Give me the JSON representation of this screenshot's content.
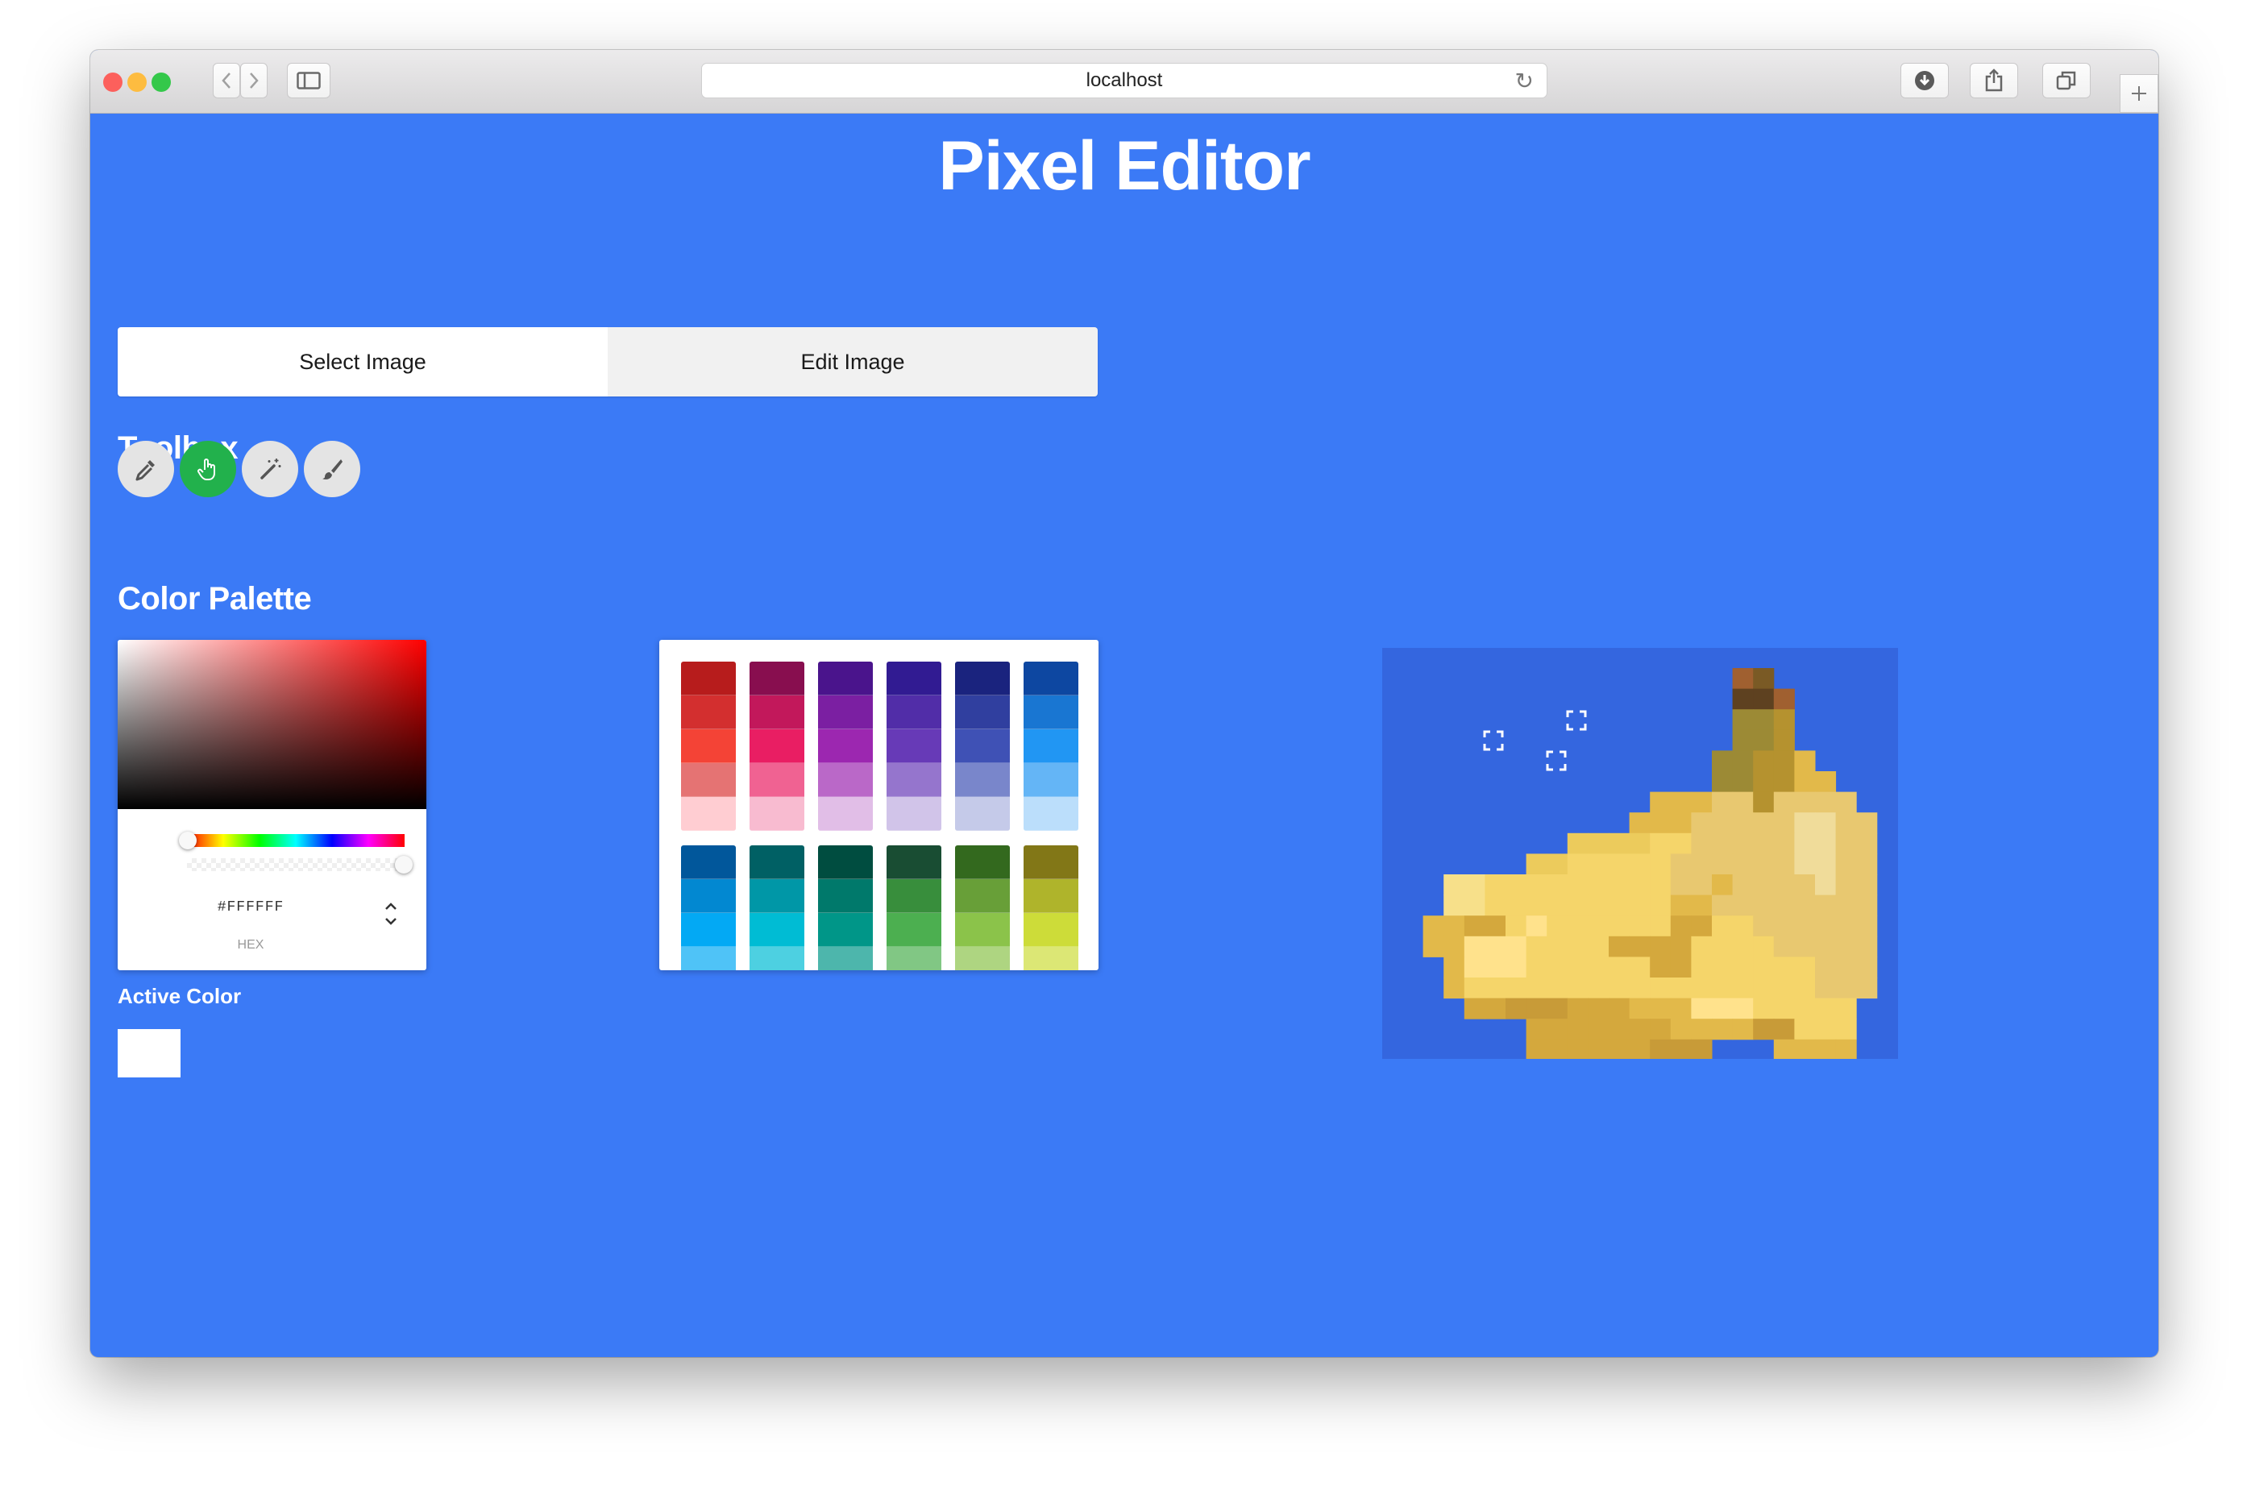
{
  "browser": {
    "url": "localhost"
  },
  "app": {
    "title": "Pixel Editor"
  },
  "tabs": [
    {
      "label": "Select Image",
      "active": true
    },
    {
      "label": "Edit Image",
      "active": false
    }
  ],
  "toolbox": {
    "heading": "Toolbox",
    "tools": [
      {
        "icon": "eyedropper-icon",
        "selected": false
      },
      {
        "icon": "hand-pointer-icon",
        "selected": true
      },
      {
        "icon": "magic-wand-icon",
        "selected": false
      },
      {
        "icon": "paintbrush-icon",
        "selected": false
      }
    ]
  },
  "palette": {
    "heading": "Color Palette",
    "picker": {
      "hex_value": "#FFFFFF",
      "format_label": "HEX",
      "hue_color": "#ff0000"
    },
    "active_color_label": "Active Color",
    "active_color": "#ffffff",
    "swatch_groups": [
      [
        [
          "#b71c1c",
          "#d32f2f",
          "#f44336",
          "#e57373",
          "#ffcdd2"
        ],
        [
          "#880e4f",
          "#c2185b",
          "#e91e63",
          "#f06292",
          "#f8bbd0"
        ],
        [
          "#4a148c",
          "#7b1fa2",
          "#9c27b0",
          "#ba68c8",
          "#e1bee7"
        ],
        [
          "#311b92",
          "#512da8",
          "#673ab7",
          "#9575cd",
          "#d1c4e9"
        ],
        [
          "#1a237e",
          "#303f9f",
          "#3f51b5",
          "#7986cb",
          "#c5cae9"
        ],
        [
          "#0d47a1",
          "#1976d2",
          "#2196f3",
          "#64b5f6",
          "#bbdefb"
        ]
      ],
      [
        [
          "#01579b",
          "#0288d1",
          "#03a9f4",
          "#4fc3f7"
        ],
        [
          "#006064",
          "#0097a7",
          "#00bcd4",
          "#4dd0e1"
        ],
        [
          "#004d40",
          "#00796b",
          "#009688",
          "#4db6ac"
        ],
        [
          "#194d33",
          "#388e3c",
          "#4caf50",
          "#81c784"
        ],
        [
          "#33691e",
          "#689f38",
          "#8bc34a",
          "#aed581"
        ],
        [
          "#827717",
          "#afb42b",
          "#cddc39",
          "#dce775"
        ]
      ]
    ]
  },
  "canvas": {
    "background": "#3466df",
    "pixel_colors": {
      "a": "#f7e08a",
      "b": "#f5d56a",
      "c": "#eccb5c",
      "d": "#e2b94a",
      "e": "#d4a83d",
      "f": "#c89b38",
      "g": "#b5922f",
      "h": "#9c8a35",
      "i": "#7a5a25",
      "j": "#5e4120",
      "k": "#a06030",
      "l": "#f0dc9a",
      "m": "#e8c870",
      "n": "#ffe28c"
    },
    "pixel_rows": [
      "................ki..........",
      "................jjk.........",
      "................hhg.........",
      "................hhg.........",
      "...............hhggd........",
      "...............hhggdd.......",
      "............dddmmgmmmm......",
      "...........dddmmmmmllmm.....",
      "........ccccbbmmmmmllmm.....",
      "......ccbbbbbmmmmmmllmm.....",
      "..aabbbbbbbbbmmdmmmmlmm.....",
      "..aabbbbbbbbbddmmmmmmmm.....",
      ".ddeebnbbbbbbeebbmmmmmm.....",
      ".ddnnnbbbbeeeebbbbmmmmm.....",
      "..dnnnbbbbbbeebbbbbbmmm.....",
      "..dbbbbbbbbbbbbbbbbbmmm.....",
      "...eefffeeedddnnnbbbbb......",
      "......eeeeeeeddddffbbb......",
      "......eeeeeefff...dddd......",
      ".......eeeee.......dd......."
    ]
  }
}
